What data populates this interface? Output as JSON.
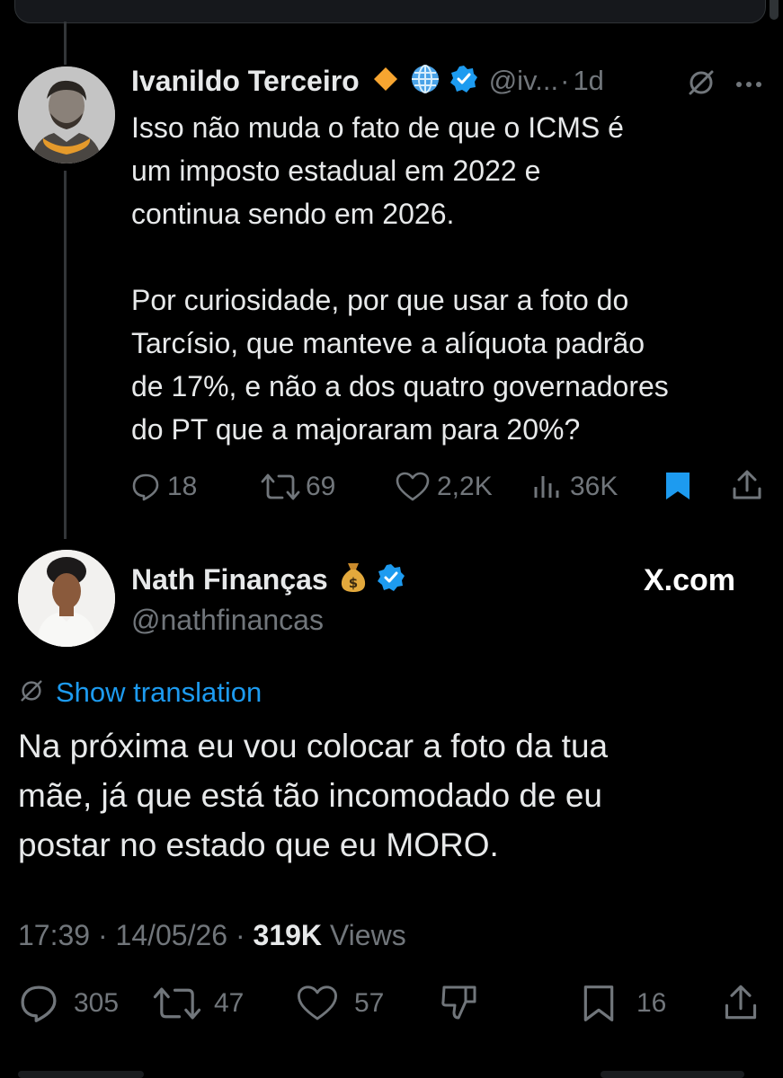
{
  "reply": {
    "author_name": "Ivanildo Terceiro",
    "handle": "@iv...",
    "separator": "·",
    "time": "1d",
    "text": "Isso não muda o fato de que o ICMS é\num imposto estadual em 2022 e\ncontinua sendo em 2026.\n\nPor curiosidade, por que usar a foto do\nTarcísio, que manteve a alíquota padrão\nde 17%, e não a dos quatro governadores\ndo PT que a majoraram para 20%?",
    "actions": {
      "replies": "18",
      "reposts": "69",
      "likes": "2,2K",
      "views": "36K"
    }
  },
  "main_tweet": {
    "author_name": "Nath Finanças",
    "handle": "@nathfinancas",
    "watermark": "X.com",
    "show_translation": "Show translation",
    "text": "Na próxima eu vou colocar a foto da tua\nmãe, já que está tão incomodado de eu\npostar no estado que eu MORO.",
    "meta": {
      "time": "17:39",
      "date": "14/05/26",
      "views_count": "319K",
      "views_label": "Views"
    },
    "actions": {
      "replies": "305",
      "reposts": "47",
      "likes": "57",
      "bookmarks": "16"
    }
  },
  "colors": {
    "background": "#000000",
    "text": "#e7e9ea",
    "muted": "#71767b",
    "link": "#1d9bf0",
    "verified": "#1d9bf0",
    "gold_badge": "#f7a530"
  }
}
